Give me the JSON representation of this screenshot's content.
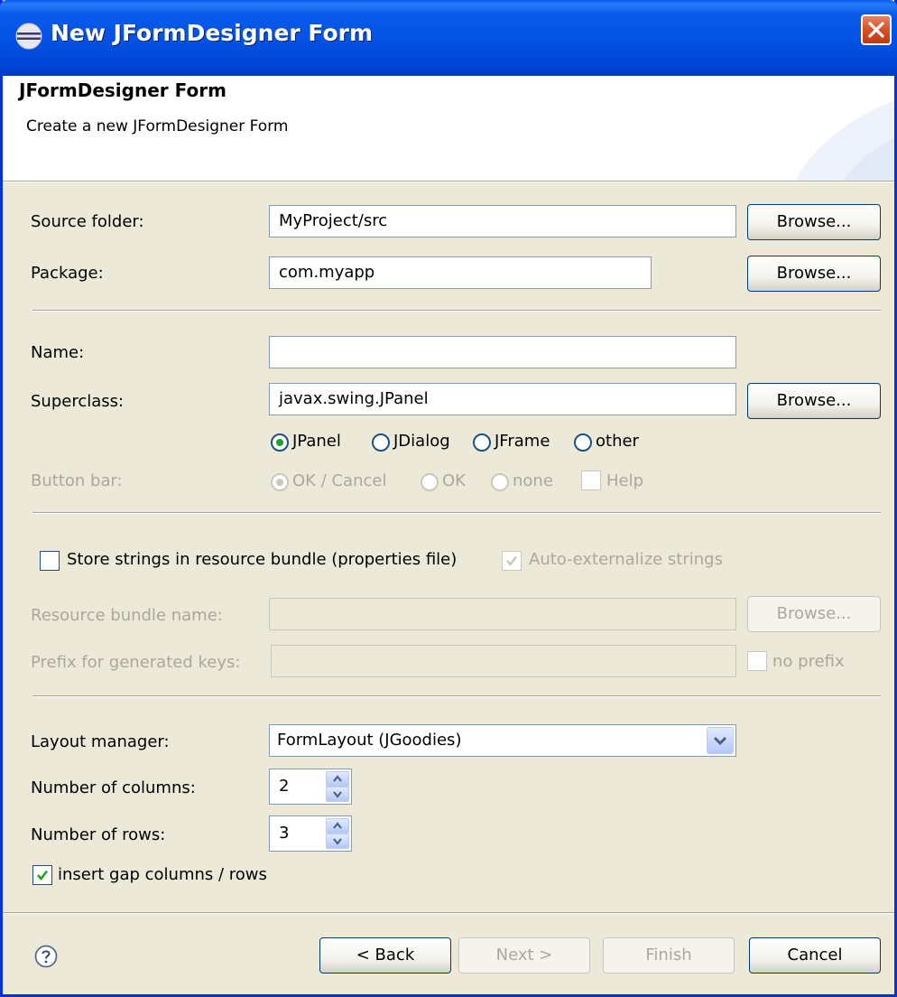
{
  "window": {
    "title": "New JFormDesigner Form",
    "icon": "eclipse-icon",
    "close_icon": "close-icon"
  },
  "header": {
    "title": "JFormDesigner Form",
    "description": "Create a new JFormDesigner Form"
  },
  "source": {
    "folder_label": "Source folder:",
    "folder_value": "MyProject/src",
    "folder_browse": "Browse...",
    "package_label": "Package:",
    "package_value": "com.myapp",
    "package_browse": "Browse..."
  },
  "class": {
    "name_label": "Name:",
    "name_value": "",
    "superclass_label": "Superclass:",
    "superclass_value": "javax.swing.JPanel",
    "superclass_browse": "Browse...",
    "superclass_options": [
      {
        "label": "JPanel",
        "selected": true
      },
      {
        "label": "JDialog",
        "selected": false
      },
      {
        "label": "JFrame",
        "selected": false
      },
      {
        "label": "other",
        "selected": false
      }
    ],
    "button_bar_label": "Button bar:",
    "button_bar_options": [
      {
        "label": "OK / Cancel",
        "selected": true
      },
      {
        "label": "OK",
        "selected": false
      },
      {
        "label": "none",
        "selected": false
      }
    ],
    "help_label": "Help",
    "help_checked": false
  },
  "resources": {
    "store_label": "Store strings in resource bundle (properties file)",
    "store_checked": false,
    "auto_label": "Auto-externalize strings",
    "auto_checked": true,
    "bundle_label": "Resource bundle name:",
    "bundle_value": "",
    "bundle_browse": "Browse...",
    "prefix_label": "Prefix for generated keys:",
    "prefix_value": "",
    "no_prefix_label": "no prefix",
    "no_prefix_checked": false
  },
  "layout": {
    "manager_label": "Layout manager:",
    "manager_value": "FormLayout (JGoodies)",
    "columns_label": "Number of columns:",
    "columns_value": "2",
    "rows_label": "Number of rows:",
    "rows_value": "3",
    "gap_label": "insert gap columns / rows",
    "gap_checked": true
  },
  "footer": {
    "help_icon": "help-icon",
    "back": "< Back",
    "next": "Next >",
    "finish": "Finish",
    "cancel": "Cancel"
  }
}
